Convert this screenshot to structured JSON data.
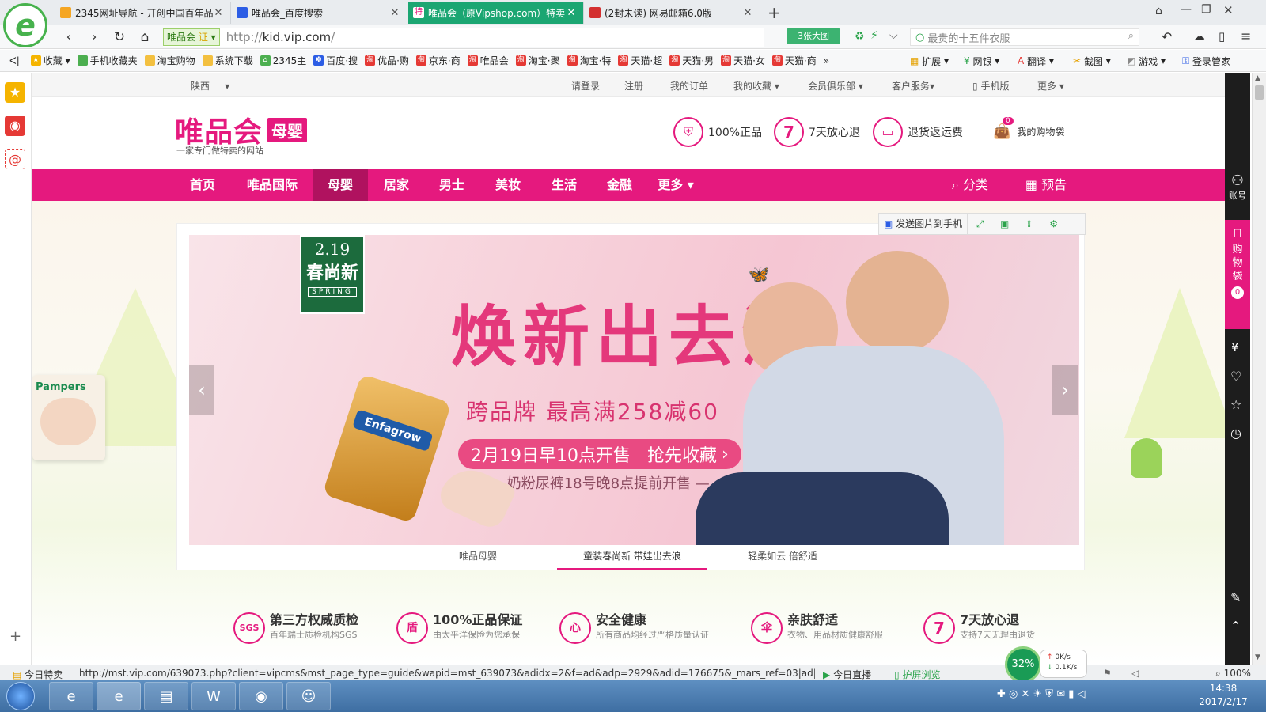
{
  "tabs": [
    {
      "title": "2345网址导航 - 开创中国百年品",
      "favicon_color": "#f5a623",
      "active": false
    },
    {
      "title": "唯品会_百度搜索",
      "favicon_color": "#2c5de5",
      "active": false
    },
    {
      "title": "唯品会（原Vipshop.com）特卖",
      "favicon_color": "#e5197e",
      "active": true
    },
    {
      "title": "(2封未读) 网易邮箱6.0版",
      "favicon_color": "#d32f2f",
      "active": false
    }
  ],
  "newtab_label": "+",
  "navbar": {
    "cert_label": "唯品会",
    "cert_badge": "证",
    "url_prefix": "http://",
    "url_host": "kid.vip.com",
    "url_path": "/",
    "bigimg_label": "3张大图",
    "search_placeholder": "最贵的十五件衣服"
  },
  "bookmarks": [
    {
      "label": "收藏",
      "icon": "star-icon",
      "color": "#f5b400"
    },
    {
      "label": "手机收藏夹",
      "icon": "phone-icon",
      "color": "#4caf50"
    },
    {
      "label": "淘宝购物",
      "icon": "folder-icon",
      "color": "#f3c040"
    },
    {
      "label": "系统下载",
      "icon": "folder-icon",
      "color": "#f3c040"
    },
    {
      "label": "2345主",
      "icon": "house-icon",
      "color": "#4caf50"
    },
    {
      "label": "百度·搜",
      "icon": "paw-icon",
      "color": "#2c5de5"
    },
    {
      "label": "优品·购",
      "icon": "tao-icon",
      "color": "#e53935"
    },
    {
      "label": "京东·商",
      "icon": "tao-icon",
      "color": "#e53935"
    },
    {
      "label": "唯品会",
      "icon": "tao-icon",
      "color": "#e53935"
    },
    {
      "label": "淘宝·聚",
      "icon": "tao-icon",
      "color": "#e53935"
    },
    {
      "label": "淘宝·特",
      "icon": "tao-icon",
      "color": "#e53935"
    },
    {
      "label": "天猫·超",
      "icon": "tao-icon",
      "color": "#e53935"
    },
    {
      "label": "天猫·男",
      "icon": "tao-icon",
      "color": "#e53935"
    },
    {
      "label": "天猫·女",
      "icon": "tao-icon",
      "color": "#e53935"
    },
    {
      "label": "天猫·商",
      "icon": "tao-icon",
      "color": "#e53935"
    }
  ],
  "bookbar_right": [
    "扩展",
    "网银",
    "翻译",
    "截图",
    "游戏",
    "登录管家"
  ],
  "topstrip": {
    "region": "陕西",
    "links": [
      "请登录",
      "注册",
      "我的订单",
      "我的收藏",
      "会员俱乐部",
      "客户服务",
      "手机版",
      "更多"
    ]
  },
  "header": {
    "logo_text": "唯品会",
    "logo_badge": "母婴",
    "slogan": "一家专门做特卖的网站",
    "promises": [
      "100%正品",
      "7天放心退",
      "退货返运费"
    ],
    "cart_label": "我的购物袋",
    "cart_count": "0"
  },
  "mainnav": {
    "items": [
      "首页",
      "唯品国际",
      "母婴",
      "居家",
      "男士",
      "美妆",
      "生活",
      "金融",
      "更多"
    ],
    "active_index": 2,
    "right": [
      "分类",
      "预告"
    ]
  },
  "imgtools": {
    "send_label": "发送图片到手机"
  },
  "banner": {
    "date_badge": "2.19",
    "badge_title": "春尚新",
    "badge_sub": "SPRING",
    "headline": "焕新出去浪",
    "subline": "跨品牌 最高满258减60",
    "cta_time": "2月19日早10点开售",
    "cta_action": "抢先收藏",
    "note": "— 奶粉尿裤18号晚8点提前开售 —",
    "product_can": "Enfagrow",
    "side_product": "Pampers"
  },
  "banner_tabs": [
    "唯品母婴",
    "童装春尚新 带娃出去浪",
    "轻柔如云 倍舒适"
  ],
  "banner_tab_active": 1,
  "features": [
    {
      "icon": "SGS",
      "title": "第三方权威质检",
      "sub": "百年瑞士质检机构SGS"
    },
    {
      "icon": "盾",
      "title": "100%正品保证",
      "sub": "由太平洋保险为您承保"
    },
    {
      "icon": "心",
      "title": "安全健康",
      "sub": "所有商品均经过严格质量认证"
    },
    {
      "icon": "伞",
      "title": "亲肤舒适",
      "sub": "衣物、用品材质健康舒服"
    },
    {
      "icon": "7",
      "title": "7天放心退",
      "sub": "支持7天无理由退货"
    }
  ],
  "rightbar": {
    "account": "账号",
    "cart": "购物袋",
    "cart_count": "0"
  },
  "statusbar": {
    "left": "今日特卖",
    "url": "http://mst.vip.com/639073.php?client=vipcms&mst_page_type=guide&wapid=mst_639073&adidx=2&f=ad&adp=2929&adid=176675&_mars_ref=03|ad|148731",
    "live": "今日直播",
    "protect": "护屏浏览",
    "cpu": "32%",
    "up": "0K/s",
    "down": "0.1K/s",
    "zoom": "100%"
  },
  "taskbar": {
    "time": "14:38",
    "date": "2017/2/17"
  }
}
